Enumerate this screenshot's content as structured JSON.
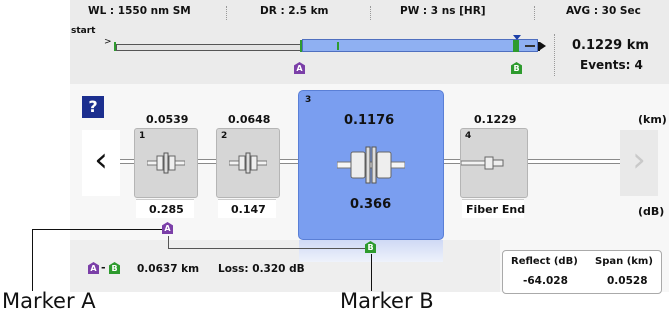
{
  "header": {
    "wavelength": "WL : 1550 nm SM",
    "distance_range": "DR : 2.5 km",
    "pulse_width": "PW : 3 ns [HR]",
    "averaging": "AVG : 30 Sec"
  },
  "overview": {
    "start_label": "start",
    "start_arrow": ">",
    "length": "0.1229 km",
    "events": "Events: 4",
    "marker_a": "A",
    "marker_b": "B"
  },
  "help": {
    "label": "?"
  },
  "units": {
    "distance": "(km)",
    "loss": "(dB)"
  },
  "events": [
    {
      "num": "1",
      "distance": "0.0539",
      "loss": "0.285"
    },
    {
      "num": "2",
      "distance": "0.0648",
      "loss": "0.147"
    },
    {
      "num": "3",
      "distance": "0.1176",
      "loss": "0.366"
    },
    {
      "num": "4",
      "distance": "0.1229",
      "loss": "Fiber End"
    }
  ],
  "nav": {
    "prev": "‹",
    "next": "›"
  },
  "markers": {
    "a": "A",
    "b": "B",
    "separator": "-",
    "span_distance": "0.0637 km",
    "loss": "Loss: 0.320 dB"
  },
  "details": {
    "reflect_header": "Reflect (dB)",
    "span_header": "Span (km)",
    "reflect_value": "-64.028",
    "span_value": "0.0528"
  },
  "captions": {
    "marker_a": "Marker A",
    "marker_b": "Marker B"
  },
  "colors": {
    "selected_card": "#7a9ef0",
    "marker_a": "#7b3fa8",
    "marker_b": "#2e9b2e",
    "help_button": "#1c2f8f"
  }
}
